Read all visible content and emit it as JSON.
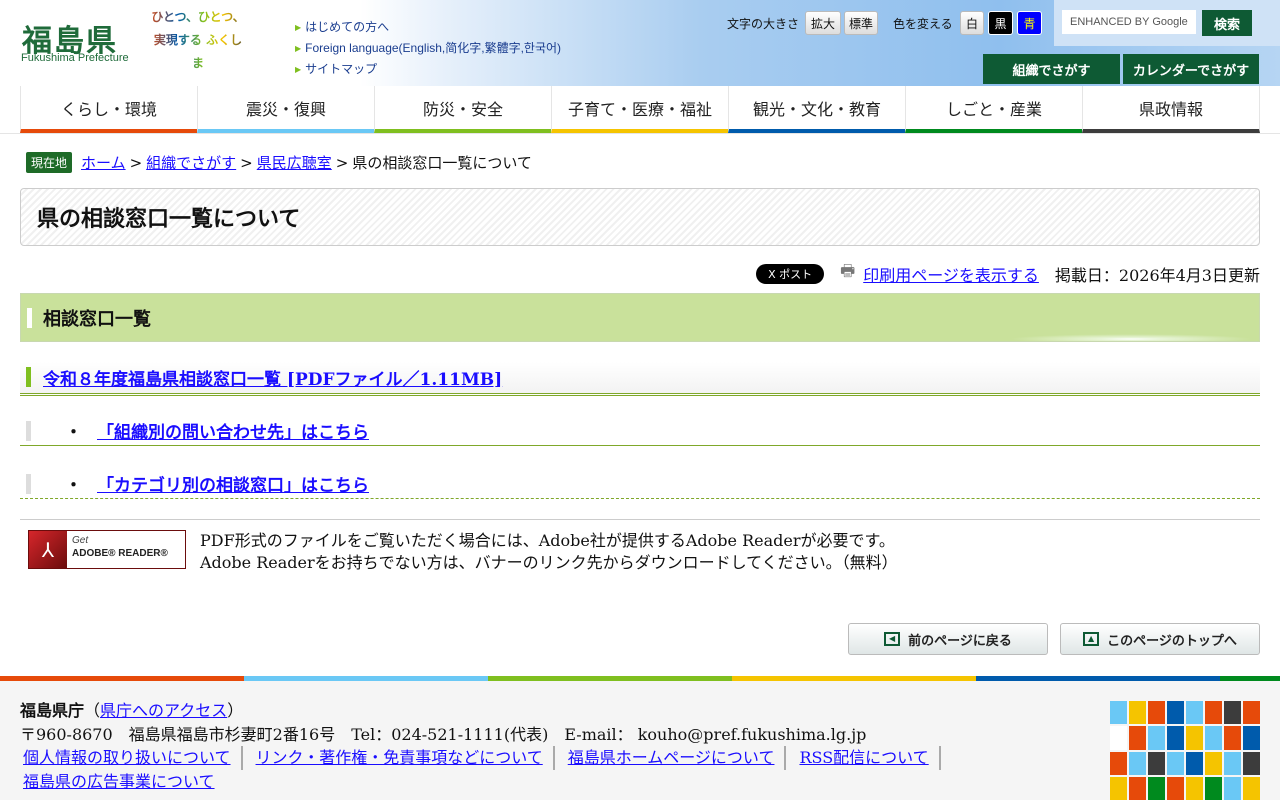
{
  "header": {
    "logo": "福島県",
    "logo_sub": "Fukushima Prefecture",
    "slogan": "ひとつ、ひとつ、実現する ふくしま",
    "links": [
      "はじめての方へ",
      "Foreign language(English,简化字,繁體字,한국어)",
      "サイトマップ"
    ],
    "font_size_label": "文字の大きさ",
    "font_large": "拡大",
    "font_normal": "標準",
    "color_label": "色を変える",
    "color_white": "白",
    "color_black": "黒",
    "color_blue": "青",
    "search_placeholder": "ENHANCED BY Google",
    "search_button": "検索",
    "org_search": "組織でさがす",
    "calendar_search": "カレンダーでさがす"
  },
  "nav": [
    {
      "label": "くらし・環境",
      "color": "#e64a0a"
    },
    {
      "label": "震災・復興",
      "color": "#6ac8f5"
    },
    {
      "label": "防災・安全",
      "color": "#7fbf1f"
    },
    {
      "label": "子育て・医療・福祉",
      "color": "#f5c400"
    },
    {
      "label": "観光・文化・教育",
      "color": "#005bac"
    },
    {
      "label": "しごと・産業",
      "color": "#008a1e"
    },
    {
      "label": "県政情報",
      "color": "#3c3c3c"
    }
  ],
  "breadcrumb": {
    "here": "現在地",
    "items": [
      "ホーム",
      "組織でさがす",
      "県民広聴室"
    ],
    "current": "県の相談窓口一覧について",
    "sep": ">"
  },
  "page_title": "県の相談窓口一覧について",
  "meta": {
    "x_post": "X ポスト",
    "print": "印刷用ページを表示する",
    "updated": "掲載日：2026年4月3日更新"
  },
  "section_title": "相談窓口一覧",
  "pdf_link": "令和８年度福島県相談窓口一覧 [PDFファイル／1.11MB]",
  "sub_links": [
    {
      "bullet": "・",
      "label": "「組織別の問い合わせ先」はこちら"
    },
    {
      "bullet": "・",
      "label": "「カテゴリ別の相談窓口」はこちら"
    }
  ],
  "adobe": {
    "banner_get": "Get",
    "banner_name": "ADOBE® READER®",
    "line1": "PDF形式のファイルをご覧いただく場合には、Adobe社が提供するAdobe Readerが必要です。",
    "line2": "Adobe Readerをお持ちでない方は、バナーのリンク先からダウンロードしてください。（無料）"
  },
  "page_nav": {
    "back": "前のページに戻る",
    "top": "このページのトップへ"
  },
  "footer": {
    "org": "福島県庁",
    "access": "県庁へのアクセス",
    "address": "〒960-8670　福島県福島市杉妻町2番16号　Tel：024-521-1111(代表)　E-mail： kouho@pref.fukushima.lg.jp",
    "links": [
      "個人情報の取り扱いについて",
      "リンク・著作権・免責事項などについて",
      "福島県ホームページについて",
      "RSS配信について",
      "福島県の広告事業について"
    ]
  }
}
